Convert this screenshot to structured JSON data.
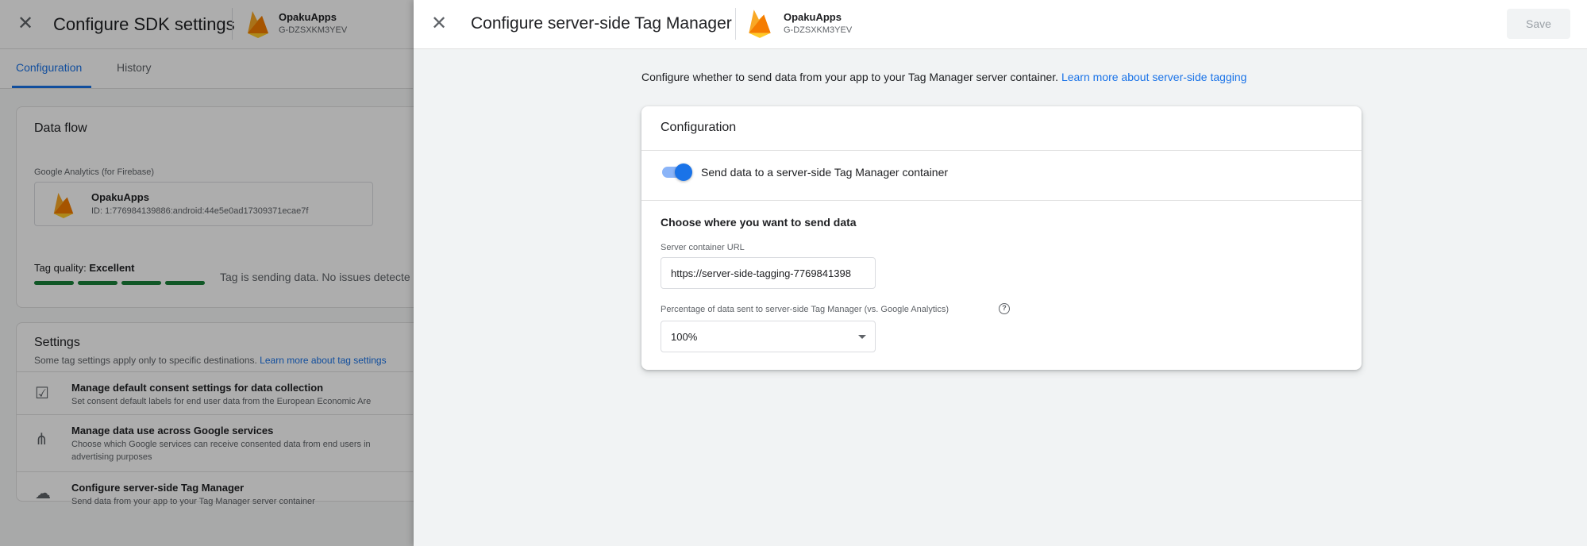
{
  "background": {
    "header": {
      "title": "Configure SDK settings",
      "app_name": "OpakuApps",
      "app_id": "G-DZSXKM3YEV"
    },
    "tabs": [
      {
        "label": "Configuration",
        "active": true
      },
      {
        "label": "History",
        "active": false
      }
    ],
    "data_flow": {
      "title": "Data flow",
      "source_label": "Google Analytics (for Firebase)",
      "stream_name": "OpakuApps",
      "stream_id": "ID: 1:776984139886:android:44e5e0ad17309371ecae7f",
      "tag_quality_label": "Tag quality:",
      "tag_quality_value": "Excellent",
      "status": "Tag is sending data. No issues detecte"
    },
    "settings": {
      "title": "Settings",
      "subtitle": "Some tag settings apply only to specific destinations.",
      "subtitle_link": "Learn more about tag settings",
      "items": [
        {
          "icon": "consent-checklist-icon",
          "title": "Manage default consent settings for data collection",
          "desc": "Set consent default labels for end user data from the European Economic Are"
        },
        {
          "icon": "share-nodes-icon",
          "title": "Manage data use across Google services",
          "desc": "Choose which Google services can receive consented data from end users in advertising purposes"
        },
        {
          "icon": "cloud-icon",
          "title": "Configure server-side Tag Manager",
          "desc": "Send data from your app to your Tag Manager server container"
        }
      ]
    }
  },
  "sheet": {
    "header": {
      "title": "Configure server-side Tag Manager",
      "app_name": "OpakuApps",
      "app_id": "G-DZSXKM3YEV",
      "save_label": "Save"
    },
    "intro_text": "Configure whether to send data from your app to your Tag Manager server container.",
    "intro_link": "Learn more about server-side tagging",
    "card": {
      "title": "Configuration",
      "toggle_label": "Send data to a server-side Tag Manager container",
      "toggle_on": true,
      "section_title": "Choose where you want to send data",
      "url_label": "Server container URL",
      "url_value": "https://server-side-tagging-7769841398",
      "percent_label": "Percentage of data sent to server-side Tag Manager (vs. Google Analytics)",
      "percent_value": "100%"
    }
  },
  "colors": {
    "accent": "#1a73e8",
    "quality_good": "#188038",
    "flame_orange": "#f9a825"
  }
}
